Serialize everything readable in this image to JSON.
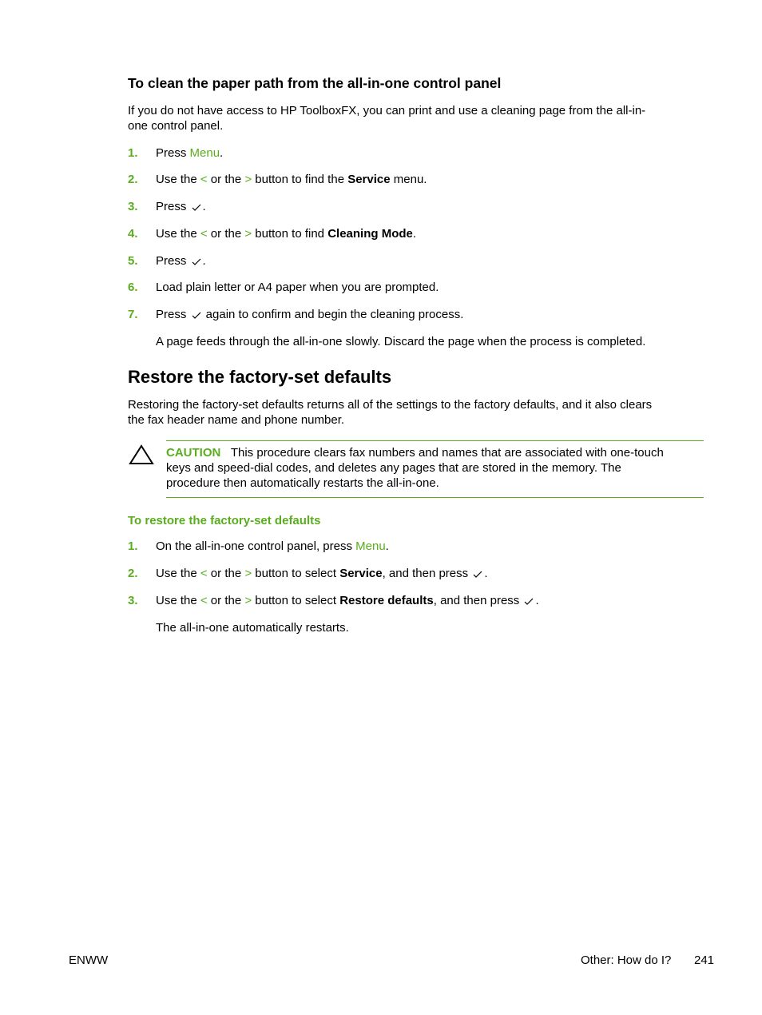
{
  "section1": {
    "heading": "To clean the paper path from the all-in-one control panel",
    "intro_line1": "If you do not have access to HP ToolboxFX, you can print and use a cleaning page from the all-in-",
    "intro_line2": "one control panel.",
    "steps": [
      {
        "num": "1.",
        "pre": "Press ",
        "link": "Menu",
        "post": "."
      },
      {
        "num": "2.",
        "pre": "Use the ",
        "lt": "<",
        "mid": " or the ",
        "gt": ">",
        "after": " button to find the ",
        "bold": "Service",
        "post": " menu."
      },
      {
        "num": "3.",
        "pre": "Press",
        "post": "."
      },
      {
        "num": "4.",
        "pre": "Use the ",
        "lt": "<",
        "mid": " or the ",
        "gt": ">",
        "after": " button to find ",
        "bold": "Cleaning Mode",
        "post": "."
      },
      {
        "num": "5.",
        "pre": "Press",
        "post": "."
      },
      {
        "num": "6.",
        "text": "Load plain letter or A4 paper when you are prompted."
      },
      {
        "num": "7.",
        "pre": "Press",
        "post": " again to confirm and begin the cleaning process."
      }
    ],
    "after_note": "A page feeds through the all-in-one slowly. Discard the page when the process is completed."
  },
  "section2": {
    "heading": "Restore the factory-set defaults",
    "intro_line1": "Restoring the factory-set defaults returns all of the settings to the factory defaults, and it also clears",
    "intro_line2": "the fax header name and phone number.",
    "caution": {
      "label": "CAUTION",
      "line1": "This procedure clears fax numbers and names that are associated with one-touch",
      "line2": "keys and speed-dial codes, and deletes any pages that are stored in the memory. The",
      "line3": "procedure then automatically restarts the all-in-one."
    },
    "subheading": "To restore the factory-set defaults",
    "steps": [
      {
        "num": "1.",
        "pre": "On the all-in-one control panel, press ",
        "link": "Menu",
        "post": "."
      },
      {
        "num": "2.",
        "pre": "Use the ",
        "lt": "<",
        "mid": " or the ",
        "gt": ">",
        "after": " button to select ",
        "bold": "Service",
        "post2": ", and then press",
        "post": "."
      },
      {
        "num": "3.",
        "pre": "Use the ",
        "lt": "<",
        "mid": " or the ",
        "gt": ">",
        "after": " button to select ",
        "bold": "Restore defaults",
        "post2": ", and then press",
        "post": "."
      }
    ],
    "after_note": "The all-in-one automatically restarts."
  },
  "footer": {
    "left": "ENWW",
    "section": "Other: How do I?",
    "page": "241"
  }
}
